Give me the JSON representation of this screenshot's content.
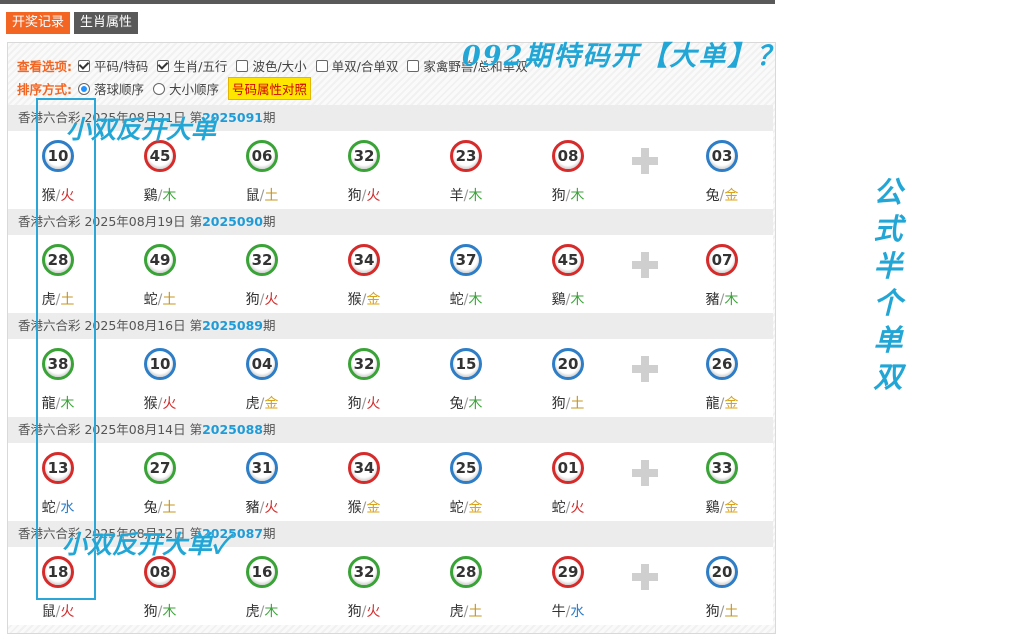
{
  "tabs": [
    {
      "label": "开奖记录",
      "active": true
    },
    {
      "label": "生肖属性",
      "active": false
    }
  ],
  "options": {
    "view_label": "查看选项:",
    "view_items": [
      {
        "label": "平码/特码",
        "checked": true
      },
      {
        "label": "生肖/五行",
        "checked": true
      },
      {
        "label": "波色/大小",
        "checked": false
      },
      {
        "label": "单双/合单双",
        "checked": false
      },
      {
        "label": "家禽野兽/总和单双",
        "checked": false
      }
    ],
    "sort_label": "排序方式:",
    "sort_items": [
      {
        "label": "落球顺序",
        "selected": true
      },
      {
        "label": "大小顺序",
        "selected": false
      }
    ],
    "compare_button": "号码属性对照"
  },
  "draws": [
    {
      "prefix": "香港六合彩 2025年08月21日 第",
      "issue": "2025091",
      "suffix": "期",
      "balls": [
        {
          "num": "10",
          "color": "blue",
          "zodiac": "猴",
          "element": "火",
          "el": "fire"
        },
        {
          "num": "45",
          "color": "red",
          "zodiac": "鷄",
          "element": "木",
          "el": "wood"
        },
        {
          "num": "06",
          "color": "green",
          "zodiac": "鼠",
          "element": "土",
          "el": "earth"
        },
        {
          "num": "32",
          "color": "green",
          "zodiac": "狗",
          "element": "火",
          "el": "fire"
        },
        {
          "num": "23",
          "color": "red",
          "zodiac": "羊",
          "element": "木",
          "el": "wood"
        },
        {
          "num": "08",
          "color": "red",
          "zodiac": "狗",
          "element": "木",
          "el": "wood"
        },
        {
          "num": "03",
          "color": "blue",
          "zodiac": "兔",
          "element": "金",
          "el": "metal"
        }
      ]
    },
    {
      "prefix": "香港六合彩 2025年08月19日 第",
      "issue": "2025090",
      "suffix": "期",
      "balls": [
        {
          "num": "28",
          "color": "green",
          "zodiac": "虎",
          "element": "土",
          "el": "earth"
        },
        {
          "num": "49",
          "color": "green",
          "zodiac": "蛇",
          "element": "土",
          "el": "earth"
        },
        {
          "num": "32",
          "color": "green",
          "zodiac": "狗",
          "element": "火",
          "el": "fire"
        },
        {
          "num": "34",
          "color": "red",
          "zodiac": "猴",
          "element": "金",
          "el": "metal"
        },
        {
          "num": "37",
          "color": "blue",
          "zodiac": "蛇",
          "element": "木",
          "el": "wood"
        },
        {
          "num": "45",
          "color": "red",
          "zodiac": "鷄",
          "element": "木",
          "el": "wood"
        },
        {
          "num": "07",
          "color": "red",
          "zodiac": "豬",
          "element": "木",
          "el": "wood"
        }
      ]
    },
    {
      "prefix": "香港六合彩 2025年08月16日 第",
      "issue": "2025089",
      "suffix": "期",
      "balls": [
        {
          "num": "38",
          "color": "green",
          "zodiac": "龍",
          "element": "木",
          "el": "wood"
        },
        {
          "num": "10",
          "color": "blue",
          "zodiac": "猴",
          "element": "火",
          "el": "fire"
        },
        {
          "num": "04",
          "color": "blue",
          "zodiac": "虎",
          "element": "金",
          "el": "metal"
        },
        {
          "num": "32",
          "color": "green",
          "zodiac": "狗",
          "element": "火",
          "el": "fire"
        },
        {
          "num": "15",
          "color": "blue",
          "zodiac": "兔",
          "element": "木",
          "el": "wood"
        },
        {
          "num": "20",
          "color": "blue",
          "zodiac": "狗",
          "element": "土",
          "el": "earth"
        },
        {
          "num": "26",
          "color": "blue",
          "zodiac": "龍",
          "element": "金",
          "el": "metal"
        }
      ]
    },
    {
      "prefix": "香港六合彩 2025年08月14日 第",
      "issue": "2025088",
      "suffix": "期",
      "balls": [
        {
          "num": "13",
          "color": "red",
          "zodiac": "蛇",
          "element": "水",
          "el": "water"
        },
        {
          "num": "27",
          "color": "green",
          "zodiac": "兔",
          "element": "土",
          "el": "earth"
        },
        {
          "num": "31",
          "color": "blue",
          "zodiac": "豬",
          "element": "火",
          "el": "fire"
        },
        {
          "num": "34",
          "color": "red",
          "zodiac": "猴",
          "element": "金",
          "el": "metal"
        },
        {
          "num": "25",
          "color": "blue",
          "zodiac": "蛇",
          "element": "金",
          "el": "metal"
        },
        {
          "num": "01",
          "color": "red",
          "zodiac": "蛇",
          "element": "火",
          "el": "fire"
        },
        {
          "num": "33",
          "color": "green",
          "zodiac": "鷄",
          "element": "金",
          "el": "metal"
        }
      ]
    },
    {
      "prefix": "香港六合彩 2025年08月12日 第",
      "issue": "2025087",
      "suffix": "期",
      "balls": [
        {
          "num": "18",
          "color": "red",
          "zodiac": "鼠",
          "element": "火",
          "el": "fire"
        },
        {
          "num": "08",
          "color": "red",
          "zodiac": "狗",
          "element": "木",
          "el": "wood"
        },
        {
          "num": "16",
          "color": "green",
          "zodiac": "虎",
          "element": "木",
          "el": "wood"
        },
        {
          "num": "32",
          "color": "green",
          "zodiac": "狗",
          "element": "火",
          "el": "fire"
        },
        {
          "num": "28",
          "color": "green",
          "zodiac": "虎",
          "element": "土",
          "el": "earth"
        },
        {
          "num": "29",
          "color": "red",
          "zodiac": "牛",
          "element": "水",
          "el": "water"
        },
        {
          "num": "20",
          "color": "blue",
          "zodiac": "狗",
          "element": "土",
          "el": "earth"
        }
      ]
    }
  ],
  "annotations": {
    "top": "092期特码开【大单】？",
    "left_1": "小双反开大单",
    "left_2": "小双反开大单✓",
    "side": [
      "公",
      "式",
      "半",
      "个",
      "单",
      "双"
    ]
  },
  "colors": {
    "accent": "#f26522",
    "issue": "#1f9bd7",
    "annotation": "#22a6d6",
    "highlight": "#ffe600"
  }
}
